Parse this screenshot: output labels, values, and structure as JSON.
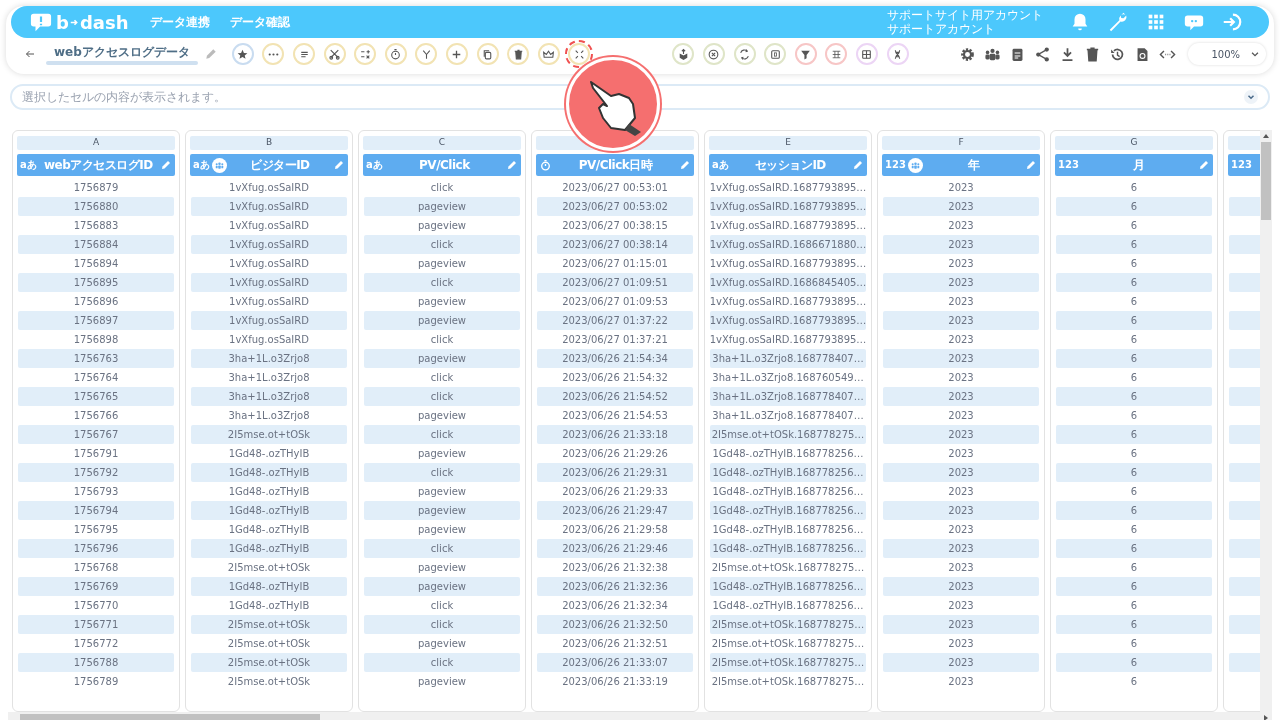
{
  "header": {
    "logo": [
      "b",
      "dash"
    ],
    "nav": [
      "データ連携",
      "データ確認"
    ],
    "account": [
      "サポートサイト用アカウント",
      "サポートアカウント"
    ]
  },
  "toolbar": {
    "title": "webアクセスログデータ",
    "zoom": "100%",
    "tools_left": [
      {
        "color": "#c9dcf0",
        "highlighted": false
      },
      {
        "color": "#f2e3b3",
        "highlighted": false
      },
      {
        "color": "#f2e3b3",
        "highlighted": false
      },
      {
        "color": "#f2e3b3",
        "highlighted": false
      },
      {
        "color": "#f2e3b3",
        "highlighted": false
      },
      {
        "color": "#f2e3b3",
        "highlighted": false
      },
      {
        "color": "#f2e3b3",
        "highlighted": false
      },
      {
        "color": "#f2e3b3",
        "highlighted": false
      },
      {
        "color": "#f2e3b3",
        "highlighted": false
      },
      {
        "color": "#f2e3b3",
        "highlighted": false
      },
      {
        "color": "#f2e3b3",
        "highlighted": false
      },
      {
        "color": "#f2e3b3",
        "highlighted": true
      }
    ],
    "tools_right": [
      {
        "color": "#dfe5c8",
        "highlighted": false
      },
      {
        "color": "#dfe5c8",
        "highlighted": false
      },
      {
        "color": "#dfe5c8",
        "highlighted": false
      },
      {
        "color": "#dfe5c8",
        "highlighted": false
      },
      {
        "color": "#f7c6c6",
        "highlighted": false
      },
      {
        "color": "#f7c6c6",
        "highlighted": false
      },
      {
        "color": "#ecd5f5",
        "highlighted": false
      },
      {
        "color": "#ecd5f5",
        "highlighted": false
      }
    ]
  },
  "cell_viewer": {
    "placeholder": "選択したセルの内容が表示されます。"
  },
  "table": {
    "columns": [
      {
        "letter": "A",
        "name": "webアクセスログID",
        "kind": "text",
        "type_label": "aあ",
        "linked": false
      },
      {
        "letter": "B",
        "name": "ビジターID",
        "kind": "text",
        "type_label": "aあ",
        "linked": true
      },
      {
        "letter": "C",
        "name": "PV/Click",
        "kind": "text",
        "type_label": "aあ",
        "linked": false
      },
      {
        "name": "PV/Click日時",
        "kind": "datetime",
        "linked": false
      },
      {
        "letter": "E",
        "name": "セッションID",
        "kind": "text",
        "type_label": "aあ",
        "linked": false
      },
      {
        "letter": "F",
        "name": "年",
        "kind": "number",
        "type_label": "123",
        "linked": true
      },
      {
        "letter": "G",
        "name": "月",
        "kind": "number",
        "type_label": "123",
        "linked": false
      },
      {
        "kind": "number",
        "type_label": "123",
        "linked": false
      }
    ],
    "rows": [
      [
        "1756879",
        "1vXfug.osSaIRD",
        "click",
        "2023/06/27 00:53:01",
        "1vXfug.osSaIRD.1687793895…",
        "2023",
        "6"
      ],
      [
        "1756880",
        "1vXfug.osSaIRD",
        "pageview",
        "2023/06/27 00:53:02",
        "1vXfug.osSaIRD.1687793895…",
        "2023",
        "6"
      ],
      [
        "1756883",
        "1vXfug.osSaIRD",
        "pageview",
        "2023/06/27 00:38:15",
        "1vXfug.osSaIRD.1687793895…",
        "2023",
        "6"
      ],
      [
        "1756884",
        "1vXfug.osSaIRD",
        "click",
        "2023/06/27 00:38:14",
        "1vXfug.osSaIRD.1686671880…",
        "2023",
        "6"
      ],
      [
        "1756894",
        "1vXfug.osSaIRD",
        "pageview",
        "2023/06/27 01:15:01",
        "1vXfug.osSaIRD.1687793895…",
        "2023",
        "6"
      ],
      [
        "1756895",
        "1vXfug.osSaIRD",
        "click",
        "2023/06/27 01:09:51",
        "1vXfug.osSaIRD.1686845405…",
        "2023",
        "6"
      ],
      [
        "1756896",
        "1vXfug.osSaIRD",
        "pageview",
        "2023/06/27 01:09:53",
        "1vXfug.osSaIRD.1687793895…",
        "2023",
        "6"
      ],
      [
        "1756897",
        "1vXfug.osSaIRD",
        "pageview",
        "2023/06/27 01:37:22",
        "1vXfug.osSaIRD.1687793895…",
        "2023",
        "6"
      ],
      [
        "1756898",
        "1vXfug.osSaIRD",
        "click",
        "2023/06/27 01:37:21",
        "1vXfug.osSaIRD.1687793895…",
        "2023",
        "6"
      ],
      [
        "1756763",
        "3ha+1L.o3Zrjo8",
        "pageview",
        "2023/06/26 21:54:34",
        "3ha+1L.o3Zrjo8.168778407…",
        "2023",
        "6"
      ],
      [
        "1756764",
        "3ha+1L.o3Zrjo8",
        "click",
        "2023/06/26 21:54:32",
        "3ha+1L.o3Zrjo8.168760549…",
        "2023",
        "6"
      ],
      [
        "1756765",
        "3ha+1L.o3Zrjo8",
        "click",
        "2023/06/26 21:54:52",
        "3ha+1L.o3Zrjo8.168778407…",
        "2023",
        "6"
      ],
      [
        "1756766",
        "3ha+1L.o3Zrjo8",
        "pageview",
        "2023/06/26 21:54:53",
        "3ha+1L.o3Zrjo8.168778407…",
        "2023",
        "6"
      ],
      [
        "1756767",
        "2I5mse.ot+tOSk",
        "click",
        "2023/06/26 21:33:18",
        "2I5mse.ot+tOSk.168778275…",
        "2023",
        "6"
      ],
      [
        "1756791",
        "1Gd48-.ozTHyIB",
        "pageview",
        "2023/06/26 21:29:26",
        "1Gd48-.ozTHyIB.168778256…",
        "2023",
        "6"
      ],
      [
        "1756792",
        "1Gd48-.ozTHyIB",
        "click",
        "2023/06/26 21:29:31",
        "1Gd48-.ozTHyIB.168778256…",
        "2023",
        "6"
      ],
      [
        "1756793",
        "1Gd48-.ozTHyIB",
        "pageview",
        "2023/06/26 21:29:33",
        "1Gd48-.ozTHyIB.168778256…",
        "2023",
        "6"
      ],
      [
        "1756794",
        "1Gd48-.ozTHyIB",
        "pageview",
        "2023/06/26 21:29:47",
        "1Gd48-.ozTHyIB.168778256…",
        "2023",
        "6"
      ],
      [
        "1756795",
        "1Gd48-.ozTHyIB",
        "pageview",
        "2023/06/26 21:29:58",
        "1Gd48-.ozTHyIB.168778256…",
        "2023",
        "6"
      ],
      [
        "1756796",
        "1Gd48-.ozTHyIB",
        "click",
        "2023/06/26 21:29:46",
        "1Gd48-.ozTHyIB.168778256…",
        "2023",
        "6"
      ],
      [
        "1756768",
        "2I5mse.ot+tOSk",
        "pageview",
        "2023/06/26 21:32:38",
        "2I5mse.ot+tOSk.168778275…",
        "2023",
        "6"
      ],
      [
        "1756769",
        "1Gd48-.ozTHyIB",
        "pageview",
        "2023/06/26 21:32:36",
        "1Gd48-.ozTHyIB.168778256…",
        "2023",
        "6"
      ],
      [
        "1756770",
        "1Gd48-.ozTHyIB",
        "click",
        "2023/06/26 21:32:34",
        "1Gd48-.ozTHyIB.168778256…",
        "2023",
        "6"
      ],
      [
        "1756771",
        "2I5mse.ot+tOSk",
        "click",
        "2023/06/26 21:32:50",
        "2I5mse.ot+tOSk.168778275…",
        "2023",
        "6"
      ],
      [
        "1756772",
        "2I5mse.ot+tOSk",
        "pageview",
        "2023/06/26 21:32:51",
        "2I5mse.ot+tOSk.168778275…",
        "2023",
        "6"
      ],
      [
        "1756788",
        "2I5mse.ot+tOSk",
        "click",
        "2023/06/26 21:33:07",
        "2I5mse.ot+tOSk.168778275…",
        "2023",
        "6"
      ],
      [
        "1756789",
        "2I5mse.ot+tOSk",
        "pageview",
        "2023/06/26 21:33:19",
        "2I5mse.ot+tOSk.168778275…",
        "2023",
        "6"
      ]
    ]
  }
}
